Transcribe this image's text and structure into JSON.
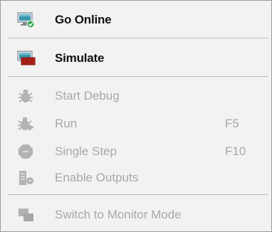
{
  "menu": {
    "items": [
      {
        "label": "Go Online",
        "shortcut": "",
        "icon": "go-online-icon",
        "enabled": true
      },
      {
        "label": "Simulate",
        "shortcut": "",
        "icon": "simulate-icon",
        "enabled": true
      },
      {
        "label": "Start Debug",
        "shortcut": "",
        "icon": "bug-icon",
        "enabled": false
      },
      {
        "label": "Run",
        "shortcut": "F5",
        "icon": "run-icon",
        "enabled": false
      },
      {
        "label": "Single Step",
        "shortcut": "F10",
        "icon": "single-step-icon",
        "enabled": false
      },
      {
        "label": "Enable Outputs",
        "shortcut": "",
        "icon": "enable-outputs-icon",
        "enabled": false
      },
      {
        "label": "Switch to Monitor Mode",
        "shortcut": "",
        "icon": "monitor-mode-icon",
        "enabled": false
      }
    ]
  },
  "colors": {
    "menu_background": "#f2f2f2",
    "enabled_text": "#111111",
    "disabled_text": "#a8a8a8",
    "monitor_teal": "#2b8aa0",
    "check_green": "#2aa34a",
    "simulate_red": "#b8261c"
  }
}
